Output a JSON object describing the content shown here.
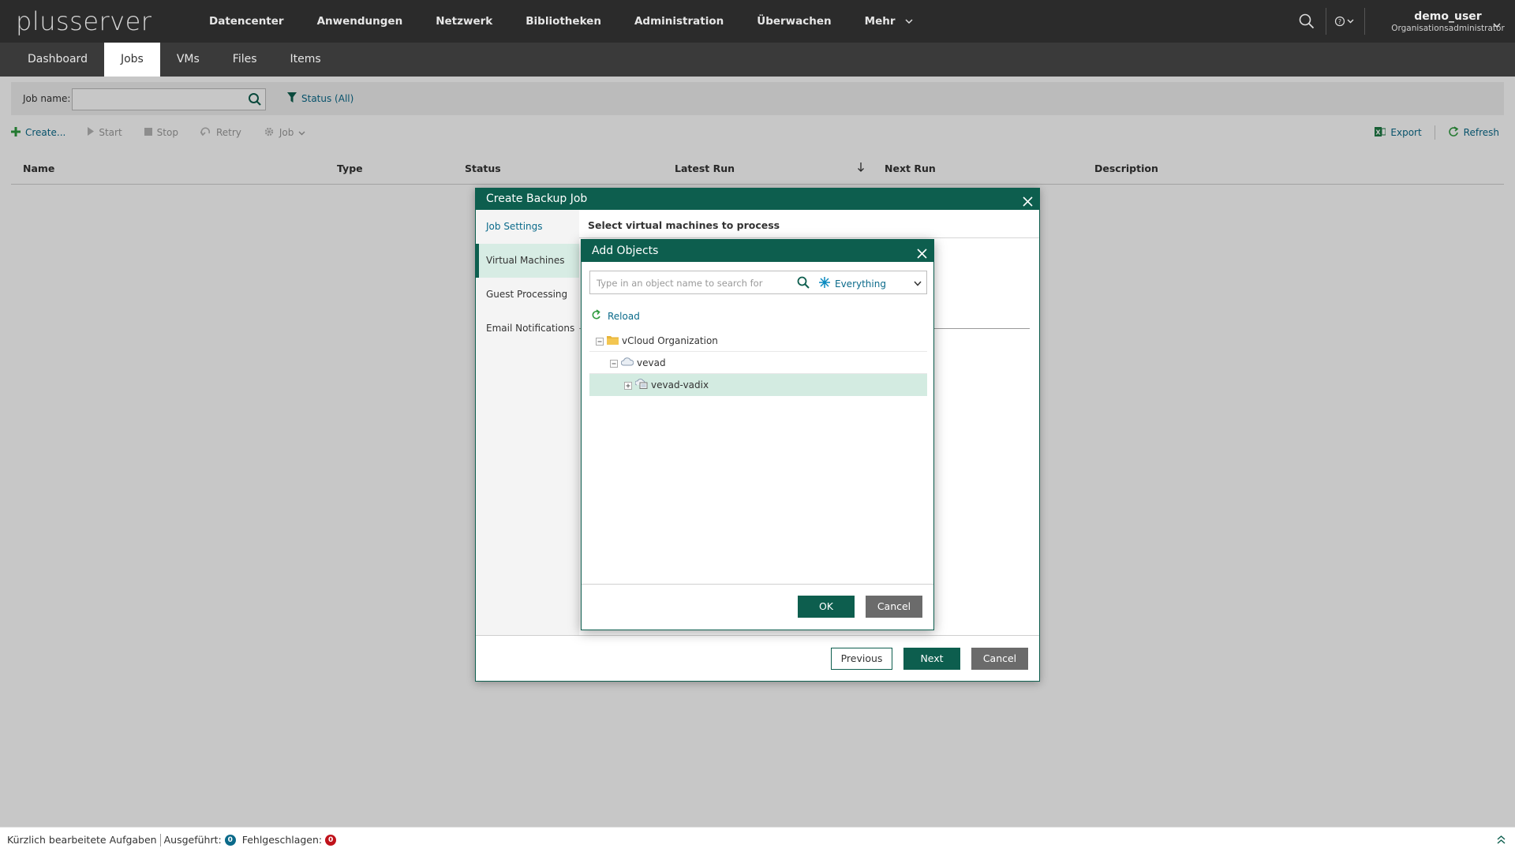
{
  "app": {
    "logo_text": "plusserver",
    "top_nav": [
      "Datencenter",
      "Anwendungen",
      "Netzwerk",
      "Bibliotheken",
      "Administration",
      "Überwachen",
      "Mehr"
    ],
    "user": {
      "name": "demo_user",
      "role": "Organisationsadministrator"
    }
  },
  "subtabs": {
    "items": [
      "Dashboard",
      "Jobs",
      "VMs",
      "Files",
      "Items"
    ],
    "active": "Jobs"
  },
  "filter": {
    "job_name_label": "Job name:",
    "job_name_value": "",
    "status_label": "Status (All)"
  },
  "toolbar": {
    "create": "Create...",
    "start": "Start",
    "stop": "Stop",
    "retry": "Retry",
    "job": "Job",
    "export": "Export",
    "refresh": "Refresh"
  },
  "grid": {
    "columns": [
      "Name",
      "Type",
      "Status",
      "Latest Run",
      "Next Run",
      "Description"
    ]
  },
  "backup_dialog": {
    "title": "Create Backup Job",
    "steps": [
      "Job Settings",
      "Virtual Machines",
      "Guest Processing",
      "Email Notifications"
    ],
    "active_step": "Virtual Machines",
    "heading": "Select virtual machines to process",
    "buttons": {
      "previous": "Previous",
      "next": "Next",
      "cancel": "Cancel"
    }
  },
  "add_objects_dialog": {
    "title": "Add Objects",
    "search_placeholder": "Type in an object name to search for",
    "filter_value": "Everything",
    "reload": "Reload",
    "tree": [
      {
        "label": "vCloud Organization",
        "level": 0,
        "icon": "folder-icon",
        "selected": false
      },
      {
        "label": "vevad",
        "level": 1,
        "icon": "cloud-icon",
        "selected": false
      },
      {
        "label": "vevad-vadix",
        "level": 2,
        "icon": "vapp-icon",
        "selected": true
      }
    ],
    "buttons": {
      "ok": "OK",
      "cancel": "Cancel"
    }
  },
  "statusbar": {
    "recent_tasks": "Kürzlich bearbeitete Aufgaben",
    "executed_label": "Ausgeführt:",
    "executed_count": "0",
    "failed_label": "Fehlgeschlagen:",
    "failed_count": "0"
  },
  "colors": {
    "brand_green": "#0d5e4e",
    "link_blue": "#0a6a8a",
    "topbar": "#2b2b2b",
    "subbar": "#3a3a3a",
    "executed_badge": "#0b6a8a",
    "failed_badge": "#c0121b"
  }
}
